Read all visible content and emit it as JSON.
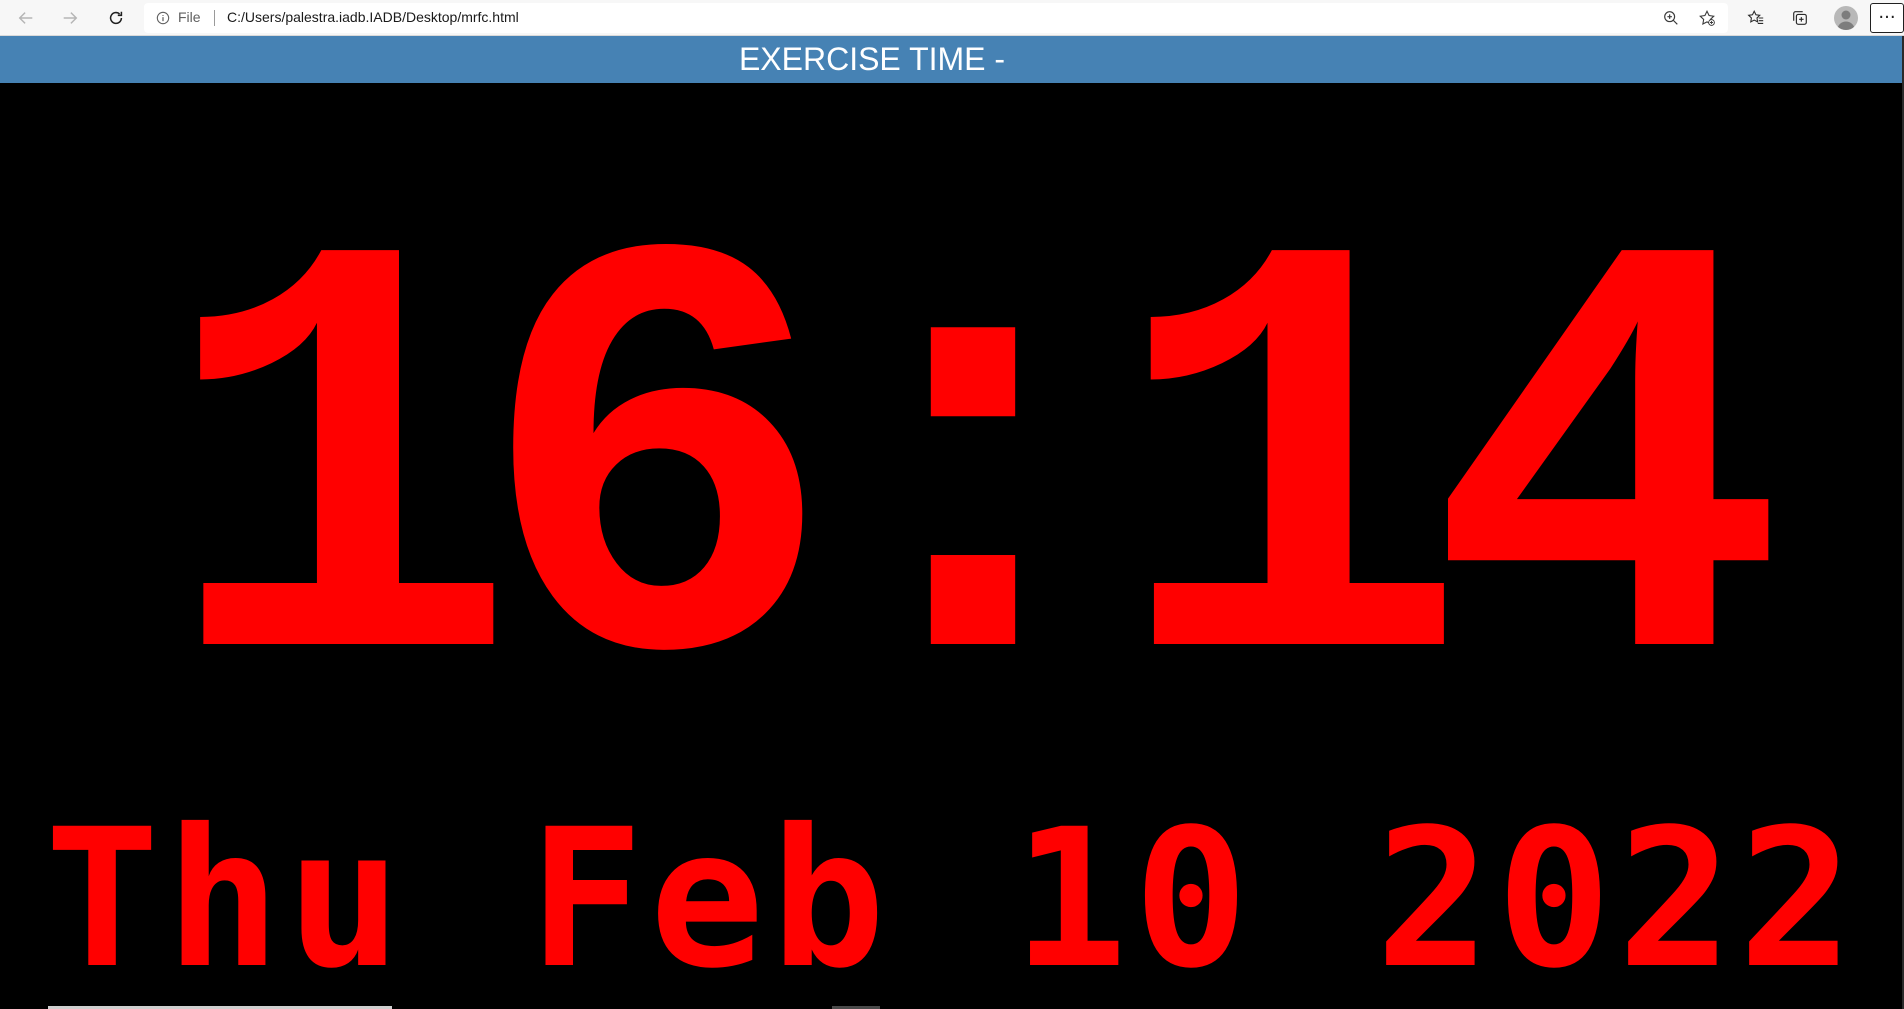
{
  "browser": {
    "scheme_label": "File",
    "url": "C:/Users/palestra.iadb.IADB/Desktop/mrfc.html",
    "more_label": "···",
    "icons": {
      "back": "back-arrow-icon",
      "forward": "forward-arrow-icon",
      "refresh": "refresh-icon",
      "info": "info-icon",
      "zoom": "zoom-icon",
      "add_favorite": "add-favorite-icon",
      "favorites": "favorites-icon",
      "collections": "collections-icon",
      "profile": "profile-avatar-icon"
    }
  },
  "page": {
    "header_title": "EXERCISE TIME -",
    "time": "16:14",
    "date": "Thu Feb 10 2022",
    "colors": {
      "header_background": "#4682b4",
      "clock_text": "#ff0000",
      "page_background": "#000000"
    }
  }
}
